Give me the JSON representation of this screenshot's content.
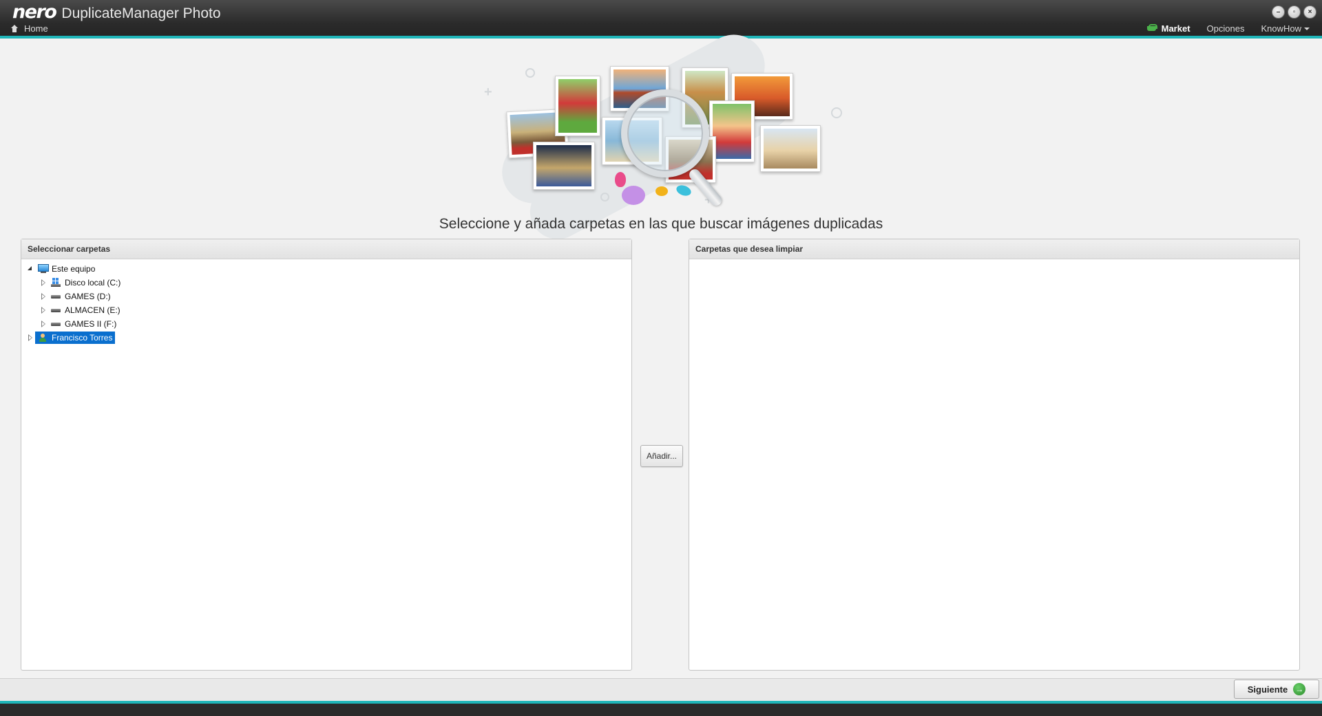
{
  "window": {
    "brand": "nero",
    "app_name": "DuplicateManager Photo",
    "home_label": "Home",
    "controls": [
      "minimize",
      "restore",
      "close"
    ]
  },
  "topnav": {
    "market_label": "Market",
    "options_label": "Opciones",
    "knowhow_label": "KnowHow"
  },
  "main": {
    "heading": "Seleccione y añada carpetas en las que buscar imágenes duplicadas"
  },
  "left_panel": {
    "title": "Seleccionar carpetas",
    "tree": {
      "root_label": "Este equipo",
      "drives": [
        {
          "label": "Disco local (C:)",
          "icon": "system-drive-icon"
        },
        {
          "label": "GAMES (D:)",
          "icon": "drive-icon"
        },
        {
          "label": "ALMACEN (E:)",
          "icon": "drive-icon"
        },
        {
          "label": "GAMES II (F:)",
          "icon": "drive-icon"
        }
      ],
      "user_label": "Francisco Torres"
    }
  },
  "add_button_label": "Añadir...",
  "right_panel": {
    "title": "Carpetas que desea limpiar"
  },
  "footer": {
    "next_label": "Siguiente"
  },
  "colors": {
    "accent": "#1fb5b8",
    "selection": "#0a6fce",
    "market_green": "#4bb34b"
  }
}
